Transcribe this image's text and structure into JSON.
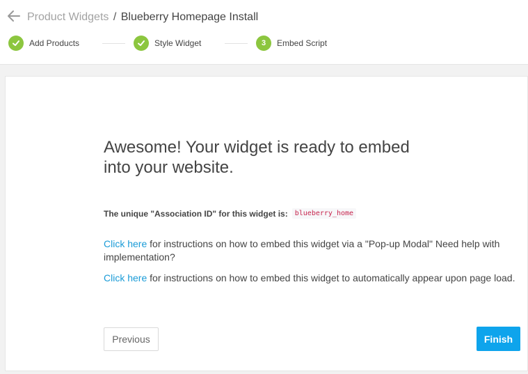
{
  "header": {
    "breadcrumb_parent": "Product Widgets",
    "breadcrumb_separator": "/",
    "breadcrumb_current": "Blueberry Homepage Install"
  },
  "steps": [
    {
      "label": "Add Products",
      "state": "complete",
      "marker": "check"
    },
    {
      "label": "Style Widget",
      "state": "complete",
      "marker": "check"
    },
    {
      "label": "Embed Script",
      "state": "current",
      "marker": "3"
    }
  ],
  "main": {
    "headline": "Awesome! Your widget is ready to embed into your website.",
    "association_label": "The unique \"Association ID\" for this widget is:",
    "association_id": "blueberry_home",
    "instructions": [
      {
        "link": "Click here",
        "text": " for instructions on how to embed this widget via a \"Pop-up Modal\" Need help with implementation?"
      },
      {
        "link": "Click here",
        "text": " for instructions on how to embed this widget to automatically appear upon page load."
      }
    ]
  },
  "buttons": {
    "previous": "Previous",
    "finish": "Finish"
  },
  "colors": {
    "step_complete": "#8cc63f",
    "link": "#1a9bd7",
    "primary_button": "#0ea4ec",
    "code_text": "#c7254e"
  }
}
